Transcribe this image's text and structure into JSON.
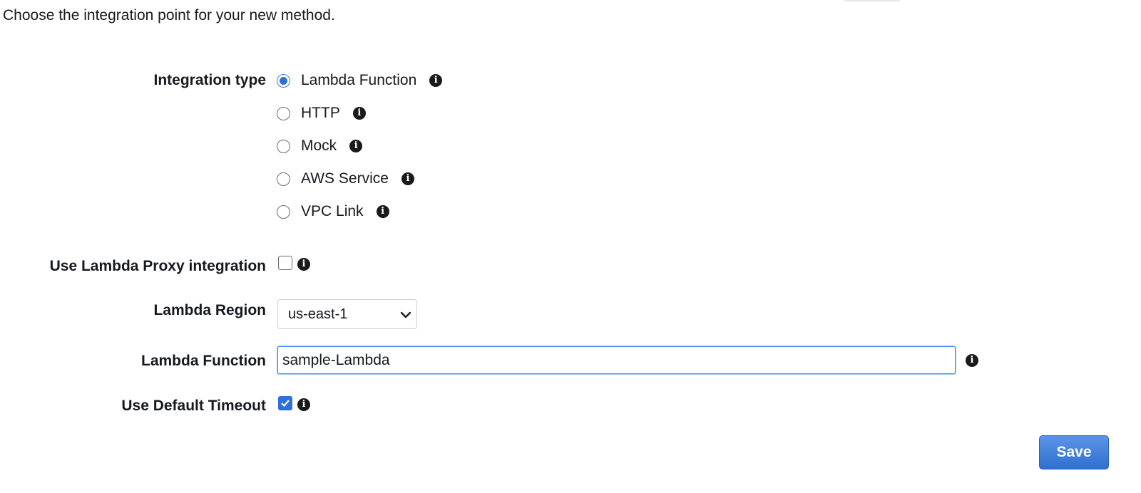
{
  "intro_text": "Choose the integration point for your new method.",
  "form": {
    "integration_type": {
      "label": "Integration type",
      "selected": "Lambda Function",
      "options": [
        {
          "label": "Lambda Function",
          "selected": true
        },
        {
          "label": "HTTP",
          "selected": false
        },
        {
          "label": "Mock",
          "selected": false
        },
        {
          "label": "AWS Service",
          "selected": false
        },
        {
          "label": "VPC Link",
          "selected": false
        }
      ]
    },
    "proxy": {
      "label": "Use Lambda Proxy integration",
      "checked": false
    },
    "region": {
      "label": "Lambda Region",
      "value": "us-east-1"
    },
    "function": {
      "label": "Lambda Function",
      "value": "sample-Lambda"
    },
    "timeout": {
      "label": "Use Default Timeout",
      "checked": true
    }
  },
  "save_label": "Save",
  "icons": {
    "info": "info-icon",
    "chevron": "chevron-down-icon",
    "check": "checkmark-icon"
  },
  "colors": {
    "accent": "#2f6fd9",
    "button_top": "#5b95e6",
    "button_bottom": "#2f6fd1",
    "text": "#16191f"
  }
}
